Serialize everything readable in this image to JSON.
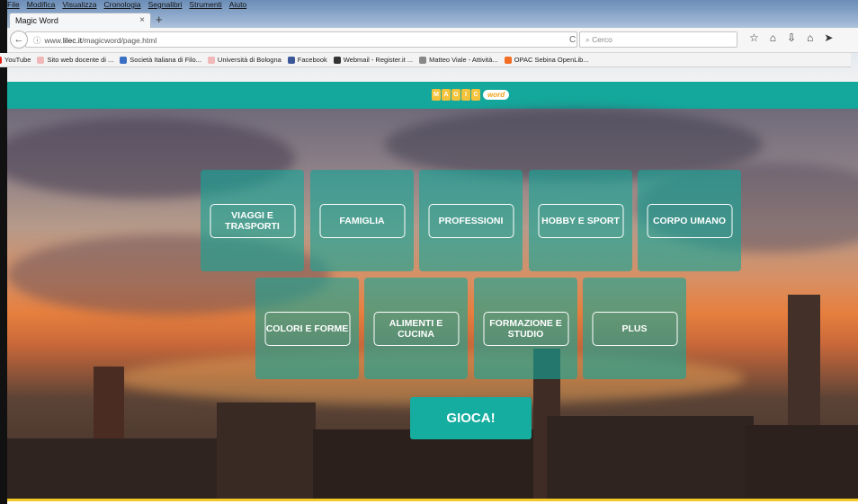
{
  "menu": [
    "File",
    "Modifica",
    "Visualizza",
    "Cronologia",
    "Segnalibri",
    "Strumenti",
    "Aiuto"
  ],
  "tab": {
    "title": "Magic Word",
    "close": "×",
    "new": "+"
  },
  "nav": {
    "back": "←",
    "info": "ⓘ",
    "url_prefix": "www.",
    "url_domain": "lilec.it",
    "url_path": "/magicword/page.html",
    "reload": "C",
    "search_placeholder": "Cerco",
    "icons": [
      "☆",
      "⌂",
      "⇩",
      "⌂",
      "➤"
    ]
  },
  "bookmarks": [
    {
      "label": "YouTube",
      "color": "#e62117"
    },
    {
      "label": "Sito web docente di ...",
      "color": "#f0b8b8"
    },
    {
      "label": "Società Italiana di Filo...",
      "color": "#3b6fc4"
    },
    {
      "label": "Università di Bologna",
      "color": "#f0b8b8"
    },
    {
      "label": "Facebook",
      "color": "#3b5998"
    },
    {
      "label": "Webmail - Register.it ...",
      "color": "#333333"
    },
    {
      "label": "Matteo Viale - Attività...",
      "color": "#888888"
    },
    {
      "label": "OPAC Sebina OpenLib...",
      "color": "#f26c21"
    }
  ],
  "logo": {
    "letters": [
      "M",
      "A",
      "G",
      "I",
      "C"
    ],
    "word": "word"
  },
  "categories_row1": [
    "VIAGGI E TRASPORTI",
    "FAMIGLIA",
    "PROFESSIONI",
    "HOBBY E SPORT",
    "CORPO UMANO"
  ],
  "categories_row2": [
    "COLORI E FORME",
    "ALIMENTI E CUCINA",
    "FORMAZIONE E STUDIO",
    "PLUS"
  ],
  "play_label": "GIOCA!",
  "colors": {
    "teal": "#14a89c",
    "accent_yellow": "#f2c928"
  }
}
